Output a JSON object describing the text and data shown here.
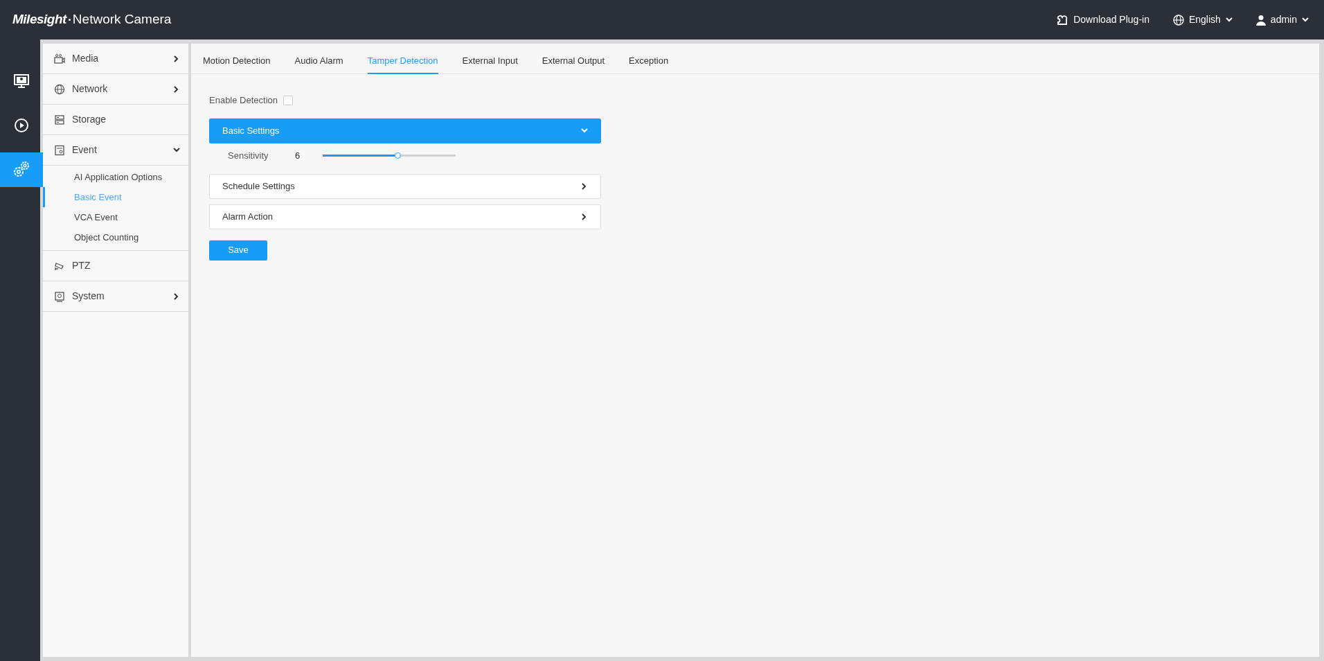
{
  "header": {
    "brand": "Milesight",
    "title": "Network Camera",
    "actions": [
      {
        "kind": "plugin",
        "label": "Download Plug-in"
      },
      {
        "kind": "language",
        "label": "English"
      },
      {
        "kind": "user",
        "label": "admin"
      }
    ]
  },
  "rail": [
    {
      "kind": "live",
      "selected": false
    },
    {
      "kind": "playback",
      "selected": false
    },
    {
      "kind": "settings",
      "selected": true
    }
  ],
  "sidebar": {
    "items": [
      {
        "kind": "submenu",
        "label": "Media",
        "expanded": false
      },
      {
        "kind": "submenu",
        "label": "Network",
        "expanded": false
      },
      {
        "kind": "page",
        "label": "Storage"
      },
      {
        "kind": "submenu",
        "label": "Event",
        "expanded": true,
        "children": [
          {
            "label": "AI Application Options",
            "selected": false
          },
          {
            "label": "Basic Event",
            "selected": true
          },
          {
            "label": "VCA Event",
            "selected": false
          },
          {
            "label": "Object Counting",
            "selected": false
          }
        ]
      },
      {
        "kind": "page",
        "label": "PTZ"
      },
      {
        "kind": "submenu",
        "label": "System",
        "expanded": false
      }
    ]
  },
  "tabs": [
    {
      "label": "Motion Detection",
      "selected": false
    },
    {
      "label": "Audio Alarm",
      "selected": false
    },
    {
      "label": "Tamper Detection",
      "selected": true
    },
    {
      "label": "External Input",
      "selected": false
    },
    {
      "label": "External Output",
      "selected": false
    },
    {
      "label": "Exception",
      "selected": false
    }
  ],
  "enable_detection": {
    "label": "Enable Detection",
    "checked": false
  },
  "panels": [
    {
      "title": "Basic Settings",
      "expanded": true,
      "fields": [
        {
          "label": "Sensitivity",
          "reading": "6",
          "level": 0.56
        }
      ]
    },
    {
      "title": "Schedule Settings",
      "expanded": false
    },
    {
      "title": "Alarm Action",
      "expanded": false
    }
  ],
  "save_button": "Save"
}
